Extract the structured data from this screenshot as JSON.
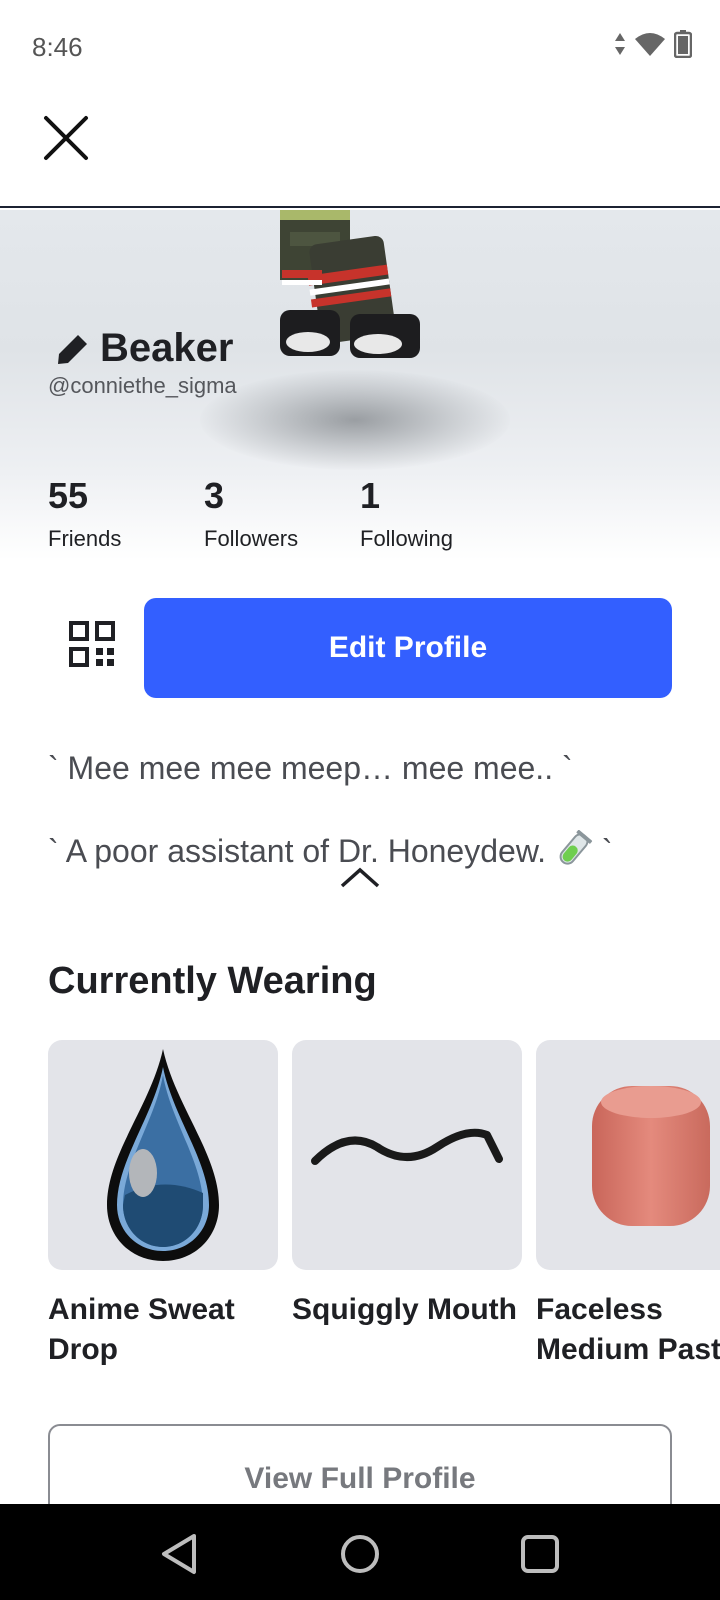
{
  "status_bar": {
    "time": "8:46",
    "icons": [
      "data-arrows-icon",
      "wifi-icon",
      "battery-icon"
    ]
  },
  "top_bar": {
    "close_icon": "close-icon"
  },
  "profile": {
    "display_name": "Beaker",
    "username": "@conniethe_sigma",
    "stats": [
      {
        "count": "55",
        "label": "Friends"
      },
      {
        "count": "3",
        "label": "Followers"
      },
      {
        "count": "1",
        "label": "Following"
      }
    ]
  },
  "actions": {
    "qr_icon": "qr-code-icon",
    "edit_label": "Edit Profile"
  },
  "bio": {
    "line1": "` Mee mee mee meep… mee mee.. `",
    "line2_text": "` A poor assistant of Dr. Honeydew. ",
    "line2_end": " `"
  },
  "currently_wearing": {
    "title": "Currently Wearing",
    "items": [
      {
        "name": "Anime Sweat Drop"
      },
      {
        "name": "Squiggly Mouth"
      },
      {
        "name": "Faceless Medium Pastel"
      }
    ]
  },
  "view_full_label": "View Full Profile",
  "colors": {
    "accent": "#335fff",
    "text": "#1f2024",
    "thumb_bg": "#e3e4e9"
  }
}
